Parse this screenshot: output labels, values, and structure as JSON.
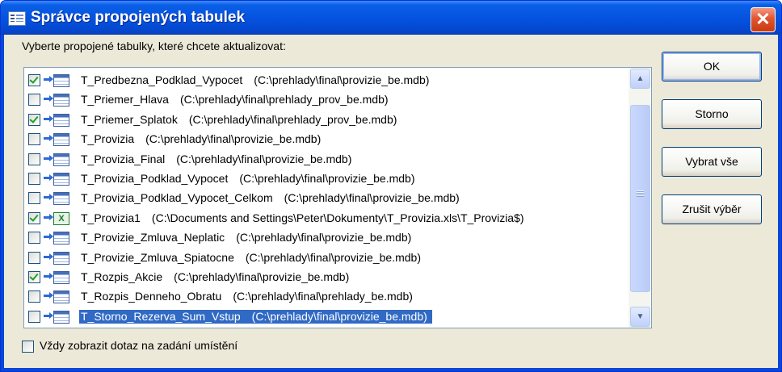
{
  "window": {
    "title": "Správce propojených tabulek",
    "close_glyph": "✕"
  },
  "prompt": "Vyberte propojené tabulky, které chcete aktualizovat:",
  "tables": [
    {
      "name": "T_Predbezna_Podklad_Vypocet",
      "path": "(C:\\prehlady\\final\\provizie_be.mdb)",
      "checked": true,
      "icon": "linked-table-icon"
    },
    {
      "name": "T_Priemer_Hlava",
      "path": "(C:\\prehlady\\final\\prehlady_prov_be.mdb)",
      "checked": false,
      "icon": "linked-table-icon"
    },
    {
      "name": "T_Priemer_Splatok",
      "path": "(C:\\prehlady\\final\\prehlady_prov_be.mdb)",
      "checked": true,
      "icon": "linked-table-icon"
    },
    {
      "name": "T_Provizia",
      "path": "(C:\\prehlady\\final\\provizie_be.mdb)",
      "checked": false,
      "icon": "linked-table-icon"
    },
    {
      "name": "T_Provizia_Final",
      "path": "(C:\\prehlady\\final\\provizie_be.mdb)",
      "checked": false,
      "icon": "linked-table-icon"
    },
    {
      "name": "T_Provizia_Podklad_Vypocet",
      "path": "(C:\\prehlady\\final\\provizie_be.mdb)",
      "checked": false,
      "icon": "linked-table-icon"
    },
    {
      "name": "T_Provizia_Podklad_Vypocet_Celkom",
      "path": "(C:\\prehlady\\final\\provizie_be.mdb)",
      "checked": false,
      "icon": "linked-table-icon"
    },
    {
      "name": "T_Provizia1",
      "path": "(C:\\Documents and Settings\\Peter\\Dokumenty\\T_Provizia.xls\\T_Provizia$)",
      "checked": true,
      "icon": "linked-excel-icon"
    },
    {
      "name": "T_Provizie_Zmluva_Neplatic",
      "path": "(C:\\prehlady\\final\\provizie_be.mdb)",
      "checked": false,
      "icon": "linked-table-icon"
    },
    {
      "name": "T_Provizie_Zmluva_Spiatocne",
      "path": "(C:\\prehlady\\final\\provizie_be.mdb)",
      "checked": false,
      "icon": "linked-table-icon"
    },
    {
      "name": "T_Rozpis_Akcie",
      "path": "(C:\\prehlady\\final\\provizie_be.mdb)",
      "checked": true,
      "icon": "linked-table-icon"
    },
    {
      "name": "T_Rozpis_Denneho_Obratu",
      "path": "(C:\\prehlady\\final\\prehlady_be.mdb)",
      "checked": false,
      "icon": "linked-table-icon"
    },
    {
      "name": "T_Storno_Rezerva_Sum_Vstup",
      "path": "(C:\\prehlady\\final\\provizie_be.mdb)",
      "checked": false,
      "icon": "linked-table-icon",
      "selected": true
    }
  ],
  "buttons": {
    "ok": "OK",
    "cancel": "Storno",
    "select_all": "Vybrat vše",
    "deselect_all": "Zrušit výběr"
  },
  "always_prompt": {
    "label": "Vždy zobrazit dotaz na zadání umístění",
    "checked": false
  },
  "scrollbar": {
    "up_glyph": "▲",
    "down_glyph": "▼"
  }
}
